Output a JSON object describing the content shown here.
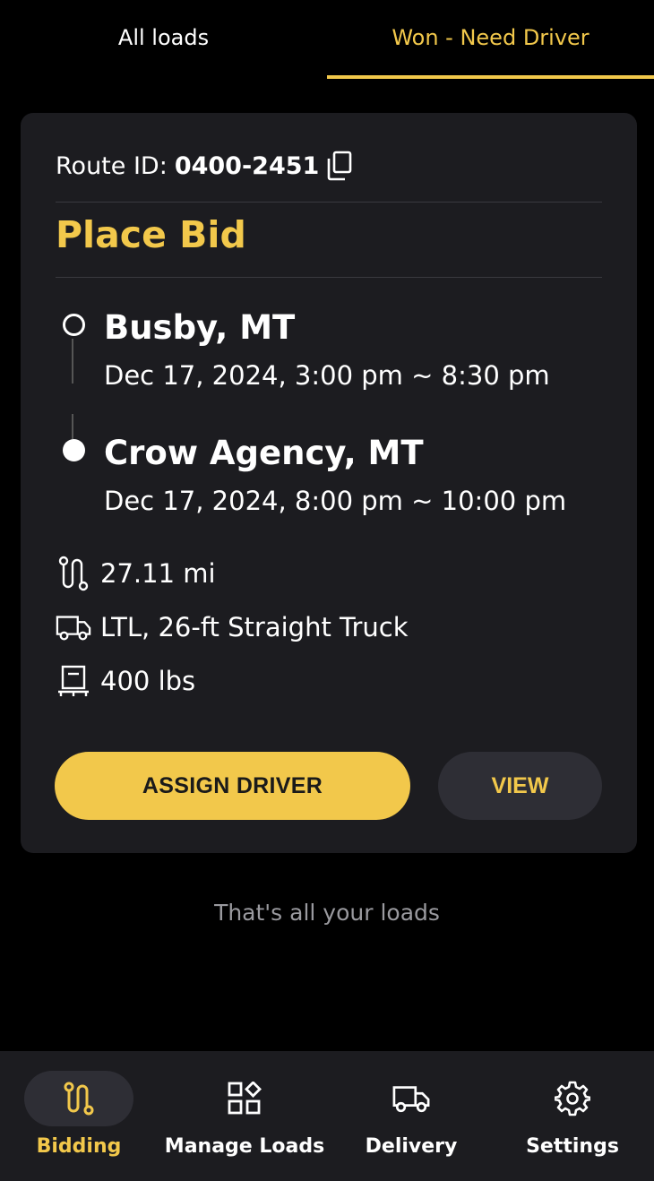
{
  "tabs": [
    {
      "label": "All loads",
      "active": false
    },
    {
      "label": "Won - Need Driver",
      "active": true
    }
  ],
  "card": {
    "route_label": "Route ID:",
    "route_id": "0400-2451",
    "status": "Place Bid",
    "origin": {
      "city": "Busby, MT",
      "time": "Dec 17, 2024, 3:00 pm ~ 8:30 pm"
    },
    "destination": {
      "city": "Crow Agency, MT",
      "time": "Dec 17, 2024, 8:00 pm ~ 10:00 pm"
    },
    "distance": "27.11 mi",
    "equipment": "LTL, 26-ft Straight Truck",
    "weight": "400 lbs",
    "assign_label": "ASSIGN DRIVER",
    "view_label": "VIEW"
  },
  "end_message": "That's all your loads",
  "nav": {
    "items": [
      {
        "label": "Bidding",
        "icon": "route-icon",
        "active": true
      },
      {
        "label": "Manage Loads",
        "icon": "grid-icon",
        "active": false
      },
      {
        "label": "Delivery",
        "icon": "truck-icon",
        "active": false
      },
      {
        "label": "Settings",
        "icon": "gear-icon",
        "active": false
      }
    ]
  },
  "colors": {
    "accent": "#f2c84b",
    "card": "#1c1c20",
    "background": "#000000"
  }
}
